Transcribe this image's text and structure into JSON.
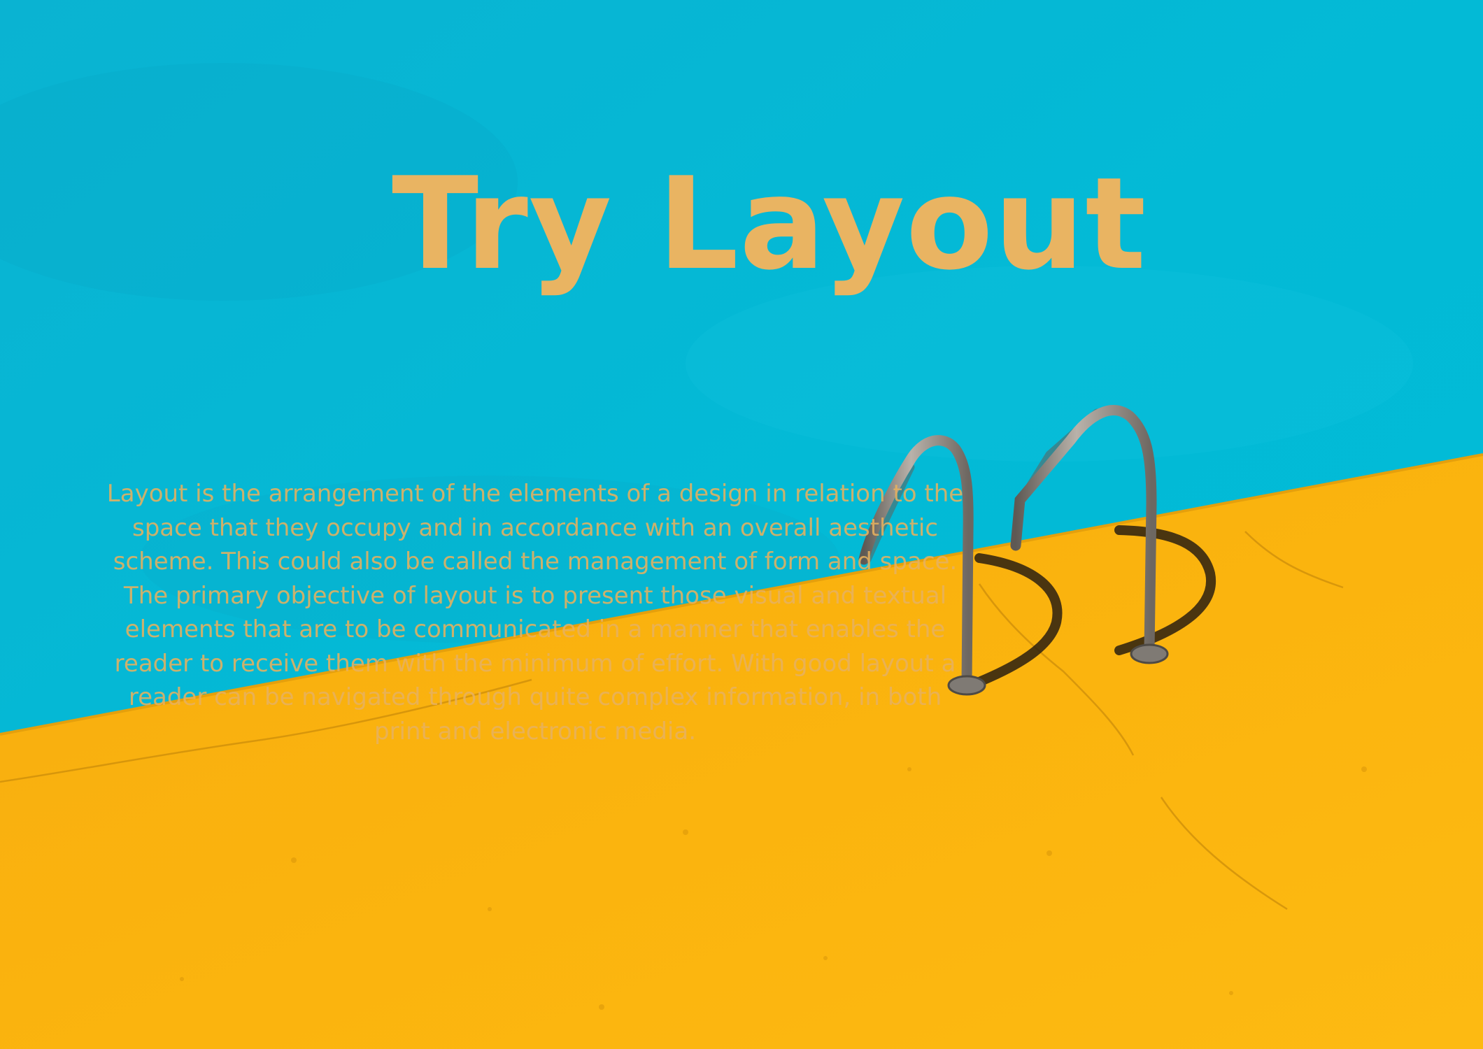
{
  "title": "Try Layout",
  "body_text": "Layout is the arrangement of the elements of a design in relation to the space that they occupy and in accordance with an overall aesthetic scheme. This could also be called the management of form and space. The primary objective of layout is to present those visual and textual elements that are to be communicated in a manner that enables the reader to receive them with the minimum of effort. With good layout a reader can be navigated through quite complex information, in both print and electronic media.",
  "colors": {
    "pool_water": "#03bad6",
    "pool_deck": "#fbb40e",
    "title_text": "#e9b462",
    "body_text": "#e7b15f",
    "ladder_metal": "#8b8580"
  }
}
